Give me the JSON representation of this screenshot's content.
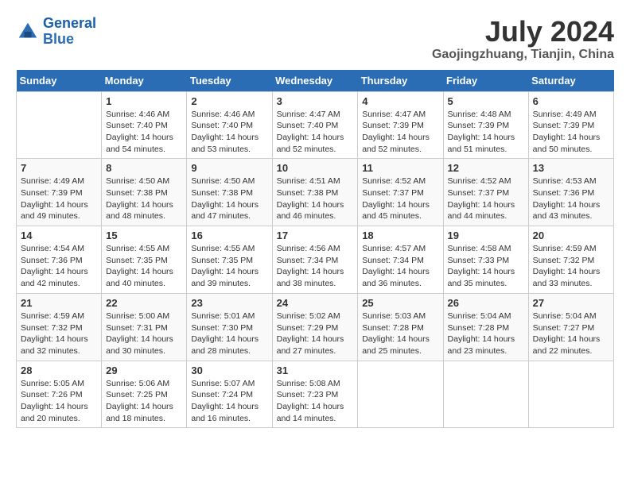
{
  "logo": {
    "line1": "General",
    "line2": "Blue"
  },
  "title": "July 2024",
  "location": "Gaojingzhuang, Tianjin, China",
  "days_of_week": [
    "Sunday",
    "Monday",
    "Tuesday",
    "Wednesday",
    "Thursday",
    "Friday",
    "Saturday"
  ],
  "weeks": [
    [
      {
        "day": "",
        "info": ""
      },
      {
        "day": "1",
        "info": "Sunrise: 4:46 AM\nSunset: 7:40 PM\nDaylight: 14 hours\nand 54 minutes."
      },
      {
        "day": "2",
        "info": "Sunrise: 4:46 AM\nSunset: 7:40 PM\nDaylight: 14 hours\nand 53 minutes."
      },
      {
        "day": "3",
        "info": "Sunrise: 4:47 AM\nSunset: 7:40 PM\nDaylight: 14 hours\nand 52 minutes."
      },
      {
        "day": "4",
        "info": "Sunrise: 4:47 AM\nSunset: 7:39 PM\nDaylight: 14 hours\nand 52 minutes."
      },
      {
        "day": "5",
        "info": "Sunrise: 4:48 AM\nSunset: 7:39 PM\nDaylight: 14 hours\nand 51 minutes."
      },
      {
        "day": "6",
        "info": "Sunrise: 4:49 AM\nSunset: 7:39 PM\nDaylight: 14 hours\nand 50 minutes."
      }
    ],
    [
      {
        "day": "7",
        "info": "Sunrise: 4:49 AM\nSunset: 7:39 PM\nDaylight: 14 hours\nand 49 minutes."
      },
      {
        "day": "8",
        "info": "Sunrise: 4:50 AM\nSunset: 7:38 PM\nDaylight: 14 hours\nand 48 minutes."
      },
      {
        "day": "9",
        "info": "Sunrise: 4:50 AM\nSunset: 7:38 PM\nDaylight: 14 hours\nand 47 minutes."
      },
      {
        "day": "10",
        "info": "Sunrise: 4:51 AM\nSunset: 7:38 PM\nDaylight: 14 hours\nand 46 minutes."
      },
      {
        "day": "11",
        "info": "Sunrise: 4:52 AM\nSunset: 7:37 PM\nDaylight: 14 hours\nand 45 minutes."
      },
      {
        "day": "12",
        "info": "Sunrise: 4:52 AM\nSunset: 7:37 PM\nDaylight: 14 hours\nand 44 minutes."
      },
      {
        "day": "13",
        "info": "Sunrise: 4:53 AM\nSunset: 7:36 PM\nDaylight: 14 hours\nand 43 minutes."
      }
    ],
    [
      {
        "day": "14",
        "info": "Sunrise: 4:54 AM\nSunset: 7:36 PM\nDaylight: 14 hours\nand 42 minutes."
      },
      {
        "day": "15",
        "info": "Sunrise: 4:55 AM\nSunset: 7:35 PM\nDaylight: 14 hours\nand 40 minutes."
      },
      {
        "day": "16",
        "info": "Sunrise: 4:55 AM\nSunset: 7:35 PM\nDaylight: 14 hours\nand 39 minutes."
      },
      {
        "day": "17",
        "info": "Sunrise: 4:56 AM\nSunset: 7:34 PM\nDaylight: 14 hours\nand 38 minutes."
      },
      {
        "day": "18",
        "info": "Sunrise: 4:57 AM\nSunset: 7:34 PM\nDaylight: 14 hours\nand 36 minutes."
      },
      {
        "day": "19",
        "info": "Sunrise: 4:58 AM\nSunset: 7:33 PM\nDaylight: 14 hours\nand 35 minutes."
      },
      {
        "day": "20",
        "info": "Sunrise: 4:59 AM\nSunset: 7:32 PM\nDaylight: 14 hours\nand 33 minutes."
      }
    ],
    [
      {
        "day": "21",
        "info": "Sunrise: 4:59 AM\nSunset: 7:32 PM\nDaylight: 14 hours\nand 32 minutes."
      },
      {
        "day": "22",
        "info": "Sunrise: 5:00 AM\nSunset: 7:31 PM\nDaylight: 14 hours\nand 30 minutes."
      },
      {
        "day": "23",
        "info": "Sunrise: 5:01 AM\nSunset: 7:30 PM\nDaylight: 14 hours\nand 28 minutes."
      },
      {
        "day": "24",
        "info": "Sunrise: 5:02 AM\nSunset: 7:29 PM\nDaylight: 14 hours\nand 27 minutes."
      },
      {
        "day": "25",
        "info": "Sunrise: 5:03 AM\nSunset: 7:28 PM\nDaylight: 14 hours\nand 25 minutes."
      },
      {
        "day": "26",
        "info": "Sunrise: 5:04 AM\nSunset: 7:28 PM\nDaylight: 14 hours\nand 23 minutes."
      },
      {
        "day": "27",
        "info": "Sunrise: 5:04 AM\nSunset: 7:27 PM\nDaylight: 14 hours\nand 22 minutes."
      }
    ],
    [
      {
        "day": "28",
        "info": "Sunrise: 5:05 AM\nSunset: 7:26 PM\nDaylight: 14 hours\nand 20 minutes."
      },
      {
        "day": "29",
        "info": "Sunrise: 5:06 AM\nSunset: 7:25 PM\nDaylight: 14 hours\nand 18 minutes."
      },
      {
        "day": "30",
        "info": "Sunrise: 5:07 AM\nSunset: 7:24 PM\nDaylight: 14 hours\nand 16 minutes."
      },
      {
        "day": "31",
        "info": "Sunrise: 5:08 AM\nSunset: 7:23 PM\nDaylight: 14 hours\nand 14 minutes."
      },
      {
        "day": "",
        "info": ""
      },
      {
        "day": "",
        "info": ""
      },
      {
        "day": "",
        "info": ""
      }
    ]
  ]
}
